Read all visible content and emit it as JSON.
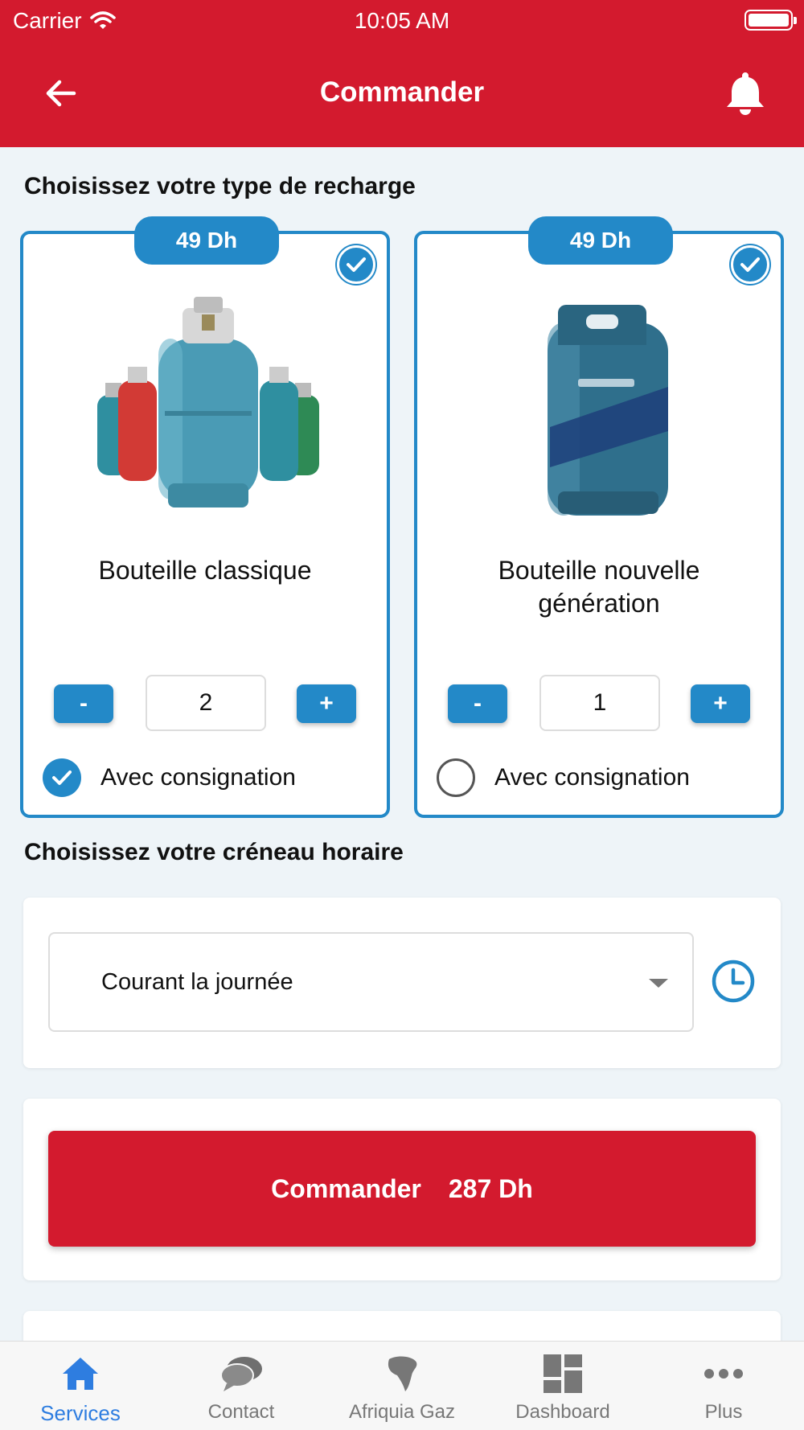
{
  "status_bar": {
    "carrier": "Carrier",
    "time": "10:05 AM"
  },
  "header": {
    "title": "Commander",
    "back_icon": "arrow-left-icon",
    "bell_icon": "bell-icon"
  },
  "recharge": {
    "title": "Choisissez votre type de recharge",
    "products": [
      {
        "price": "49 Dh",
        "name_line1": "Bouteille classique",
        "name_line2": "",
        "minus": "-",
        "plus": "+",
        "quantity": "2",
        "consign_label": "Avec consignation",
        "consign_checked": true,
        "selected": true
      },
      {
        "price": "49 Dh",
        "name_line1": "Bouteille nouvelle",
        "name_line2": "génération",
        "minus": "-",
        "plus": "+",
        "quantity": "1",
        "consign_label": "Avec consignation",
        "consign_checked": false,
        "selected": true
      }
    ]
  },
  "slot": {
    "title": "Choisissez votre créneau horaire",
    "selected": "Courant la journée",
    "icon": "clock-icon"
  },
  "order": {
    "label": "Commander",
    "total": "287 Dh"
  },
  "colors": {
    "brand_red": "#d31a2e",
    "accent_blue": "#2389c8",
    "active_tab": "#2e7de0"
  },
  "tabs": [
    {
      "label": "Services",
      "icon": "home-icon",
      "active": true
    },
    {
      "label": "Contact",
      "icon": "chat-bubbles-icon",
      "active": false
    },
    {
      "label": "Afriquia Gaz",
      "icon": "africa-map-icon",
      "active": false
    },
    {
      "label": "Dashboard",
      "icon": "dashboard-grid-icon",
      "active": false
    },
    {
      "label": "Plus",
      "icon": "more-dots-icon",
      "active": false
    }
  ]
}
